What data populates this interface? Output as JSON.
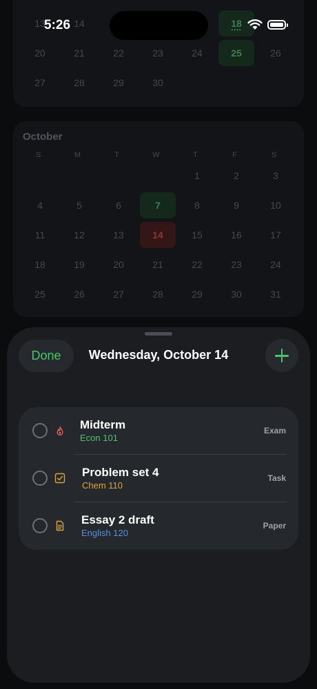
{
  "status_bar": {
    "time": "5:26"
  },
  "background_calendar": {
    "september_partial": {
      "rows": [
        [
          "13",
          "14",
          "",
          "",
          "",
          "18",
          ""
        ],
        [
          "20",
          "21",
          "22",
          "23",
          "24",
          "25",
          "26"
        ],
        [
          "27",
          "28",
          "29",
          "30",
          "",
          "",
          ""
        ]
      ],
      "highlighted_days": [
        "18",
        "25"
      ]
    },
    "october": {
      "title": "October",
      "weekday_headers": [
        "S",
        "M",
        "T",
        "W",
        "T",
        "F",
        "S"
      ],
      "rows": [
        [
          "",
          "",
          "",
          "",
          "1",
          "2",
          "3"
        ],
        [
          "4",
          "5",
          "6",
          "7",
          "8",
          "9",
          "10"
        ],
        [
          "11",
          "12",
          "13",
          "14",
          "15",
          "16",
          "17"
        ],
        [
          "18",
          "19",
          "20",
          "21",
          "22",
          "23",
          "24"
        ],
        [
          "25",
          "26",
          "27",
          "28",
          "29",
          "30",
          "31"
        ]
      ],
      "highlighted_day": "7",
      "selected_day": "14"
    }
  },
  "sheet": {
    "done_label": "Done",
    "title": "Wednesday, October 14",
    "tasks": [
      {
        "title": "Midterm",
        "course": "Econ 101",
        "type": "Exam",
        "icon": "flame-icon",
        "course_color": "#4cc46a",
        "icon_color": "#e0605a"
      },
      {
        "title": "Problem set 4",
        "course": "Chem 110",
        "type": "Task",
        "icon": "checkbox-icon",
        "course_color": "#d9a738",
        "icon_color": "#d9a738"
      },
      {
        "title": "Essay 2 draft",
        "course": "English 120",
        "type": "Paper",
        "icon": "document-icon",
        "course_color": "#5a8fe0",
        "icon_color": "#d9a738"
      }
    ]
  },
  "colors": {
    "accent": "#48c76a",
    "exam": "#e0605a"
  }
}
